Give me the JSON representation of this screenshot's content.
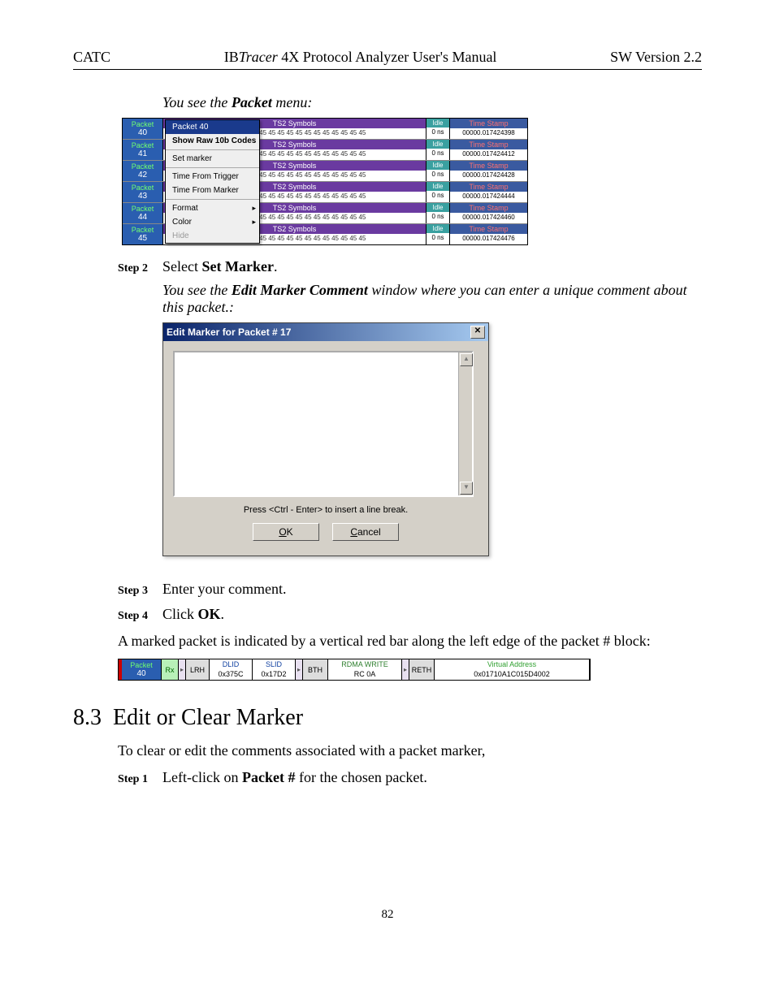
{
  "header": {
    "left": "CATC",
    "center_prefix": "IB",
    "center_italic": "Tracer",
    "center_rest": " 4X Protocol Analyzer User's Manual",
    "right": "SW Version 2.2"
  },
  "intro_line_prefix": "You see the ",
  "intro_line_bold": "Packet",
  "intro_line_suffix": " menu:",
  "trace_rows": [
    {
      "num": "40",
      "sym": "TS2 Symbols",
      "data": "45 45 45 45 45 45 45 45 45 45 45 45 45 45 45 45",
      "idle": "0 ns",
      "ts_lbl": "Time Stamp",
      "ts": "00000.017424398"
    },
    {
      "num": "41",
      "sym": "TS2 Symbols",
      "data": "45 45 45 45 45 45 45 45 45 45 45 45 45 45 45 45",
      "idle": "0 ns",
      "ts_lbl": "Time Stamp",
      "ts": "00000.017424412"
    },
    {
      "num": "42",
      "sym": "TS2 Symbols",
      "data": "45 45 45 45 45 45 45 45 45 45 45 45 45 45 45 45",
      "idle": "0 ns",
      "ts_lbl": "Time Stamp",
      "ts": "00000.017424428"
    },
    {
      "num": "43",
      "sym": "TS2 Symbols",
      "data": "45 45 45 45 45 45 45 45 45 45 45 45 45 45 45 45",
      "idle": "0 ns",
      "ts_lbl": "Time Stamp",
      "ts": "00000.017424444"
    },
    {
      "num": "44",
      "sym": "TS2 Symbols",
      "data": "45 45 45 45 45 45 45 45 45 45 45 45 45 45 45 45",
      "idle": "0 ns",
      "ts_lbl": "Time Stamp",
      "ts": "00000.017424460"
    },
    {
      "num": "45",
      "sym": "TS2 Symbols",
      "data": "45 45 45 45 45 45 45 45 45 45 45 45 45 45 45 45",
      "idle": "0 ns",
      "ts_lbl": "Time Stamp",
      "ts": "00000.017424476"
    }
  ],
  "packet_label": "Packet",
  "idle_label": "Idle",
  "ctx_menu": {
    "item_packet": "Packet 40",
    "item_raw": "Show Raw 10b Codes",
    "item_set": "Set marker",
    "item_trig": "Time From Trigger",
    "item_marker": "Time From Marker",
    "item_format": "Format",
    "item_color": "Color",
    "item_hide": "Hide"
  },
  "step2_label": "Step 2",
  "step2_text_pre": "Select ",
  "step2_text_bold": "Set Marker",
  "step2_text_post": ".",
  "instr2_pre": "You see the ",
  "instr2_bold": "Edit Marker Comment",
  "instr2_post": " window where you can enter a unique comment about this packet.:",
  "dialog": {
    "title": "Edit Marker for Packet # 17",
    "hint": "Press <Ctrl - Enter> to insert a line break.",
    "ok_u": "O",
    "ok_rest": "K",
    "cancel_u": "C",
    "cancel_rest": "ancel"
  },
  "step3_label": "Step 3",
  "step3_text": "Enter your comment.",
  "step4_label": "Step 4",
  "step4_pre": "Click ",
  "step4_bold": "OK",
  "step4_post": ".",
  "marked_para": "A marked packet is indicated by a vertical red bar along the left edge of the packet # block:",
  "marked_block": {
    "packet_label": "Packet",
    "num": "40",
    "rx": "Rx",
    "lrh": "LRH",
    "dlid_h": "DLID",
    "dlid_v": "0x375C",
    "slid_h": "SLID",
    "slid_v": "0x17D2",
    "bth": "BTH",
    "rdma_h": "RDMA WRITE",
    "rdma_v": "RC 0A",
    "reth": "RETH",
    "va_h": "Virtual Address",
    "va_v": "0x01710A1C015D4002"
  },
  "section_num": "8.3",
  "section_title": "Edit or Clear Marker",
  "section_para": "To clear or edit the comments associated with a packet marker,",
  "step1_label": "Step 1",
  "step1_pre": "Left-click on ",
  "step1_bold": "Packet #",
  "step1_post": " for the chosen packet.",
  "page_number": "82"
}
